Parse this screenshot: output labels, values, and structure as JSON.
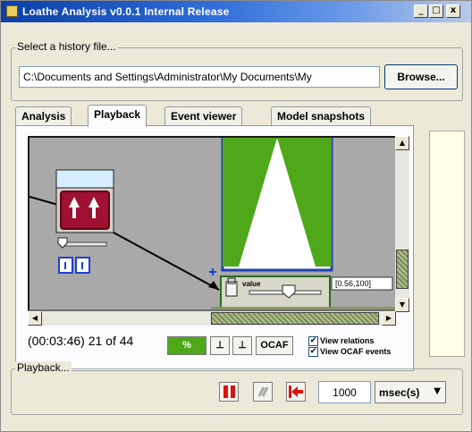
{
  "window": {
    "title": "Loathe Analysis v0.0.1 Internal Release",
    "minimize_glyph": "_",
    "maximize_glyph": "□",
    "close_glyph": "x"
  },
  "history": {
    "group_label": "Select a history file...",
    "path_value": "C:\\Documents and Settings\\Administrator\\My Documents\\My",
    "browse_label": "Browse..."
  },
  "tabs": [
    {
      "label": "Analysis",
      "active": false
    },
    {
      "label": "Playback",
      "active": true
    },
    {
      "label": "Event viewer",
      "active": false
    },
    {
      "label": "Model snapshots",
      "active": false
    }
  ],
  "canvas": {
    "background_color": "#a9a9a9",
    "accent_green": "#4fa81a",
    "node_a": {
      "icon": "up-arrows-icon",
      "slider_level": 0.1,
      "toggle_a": "I",
      "toggle_b": "I"
    },
    "node_b": {
      "value_label": "value",
      "value_range": "[0.56,100]",
      "slider_level": 0.6,
      "lock_icon": "lock-icon"
    }
  },
  "status": {
    "time_text": "(00:03:46) 21 of 44",
    "percent_label": "%",
    "step_back_label": "⊥",
    "step_fwd_label": "⊥",
    "ocaf_label": "OCAF",
    "view_relations_label": "View relations",
    "view_ocaf_events_label": "View OCAF events",
    "view_relations_checked": true,
    "view_ocaf_events_checked": true
  },
  "playback": {
    "group_label": "Playback...",
    "interval_value": "1000",
    "unit_label": "msec(s)",
    "pause_icon": "pause-icon",
    "play_icon": "play-icon",
    "rewind_icon": "rewind-icon"
  }
}
